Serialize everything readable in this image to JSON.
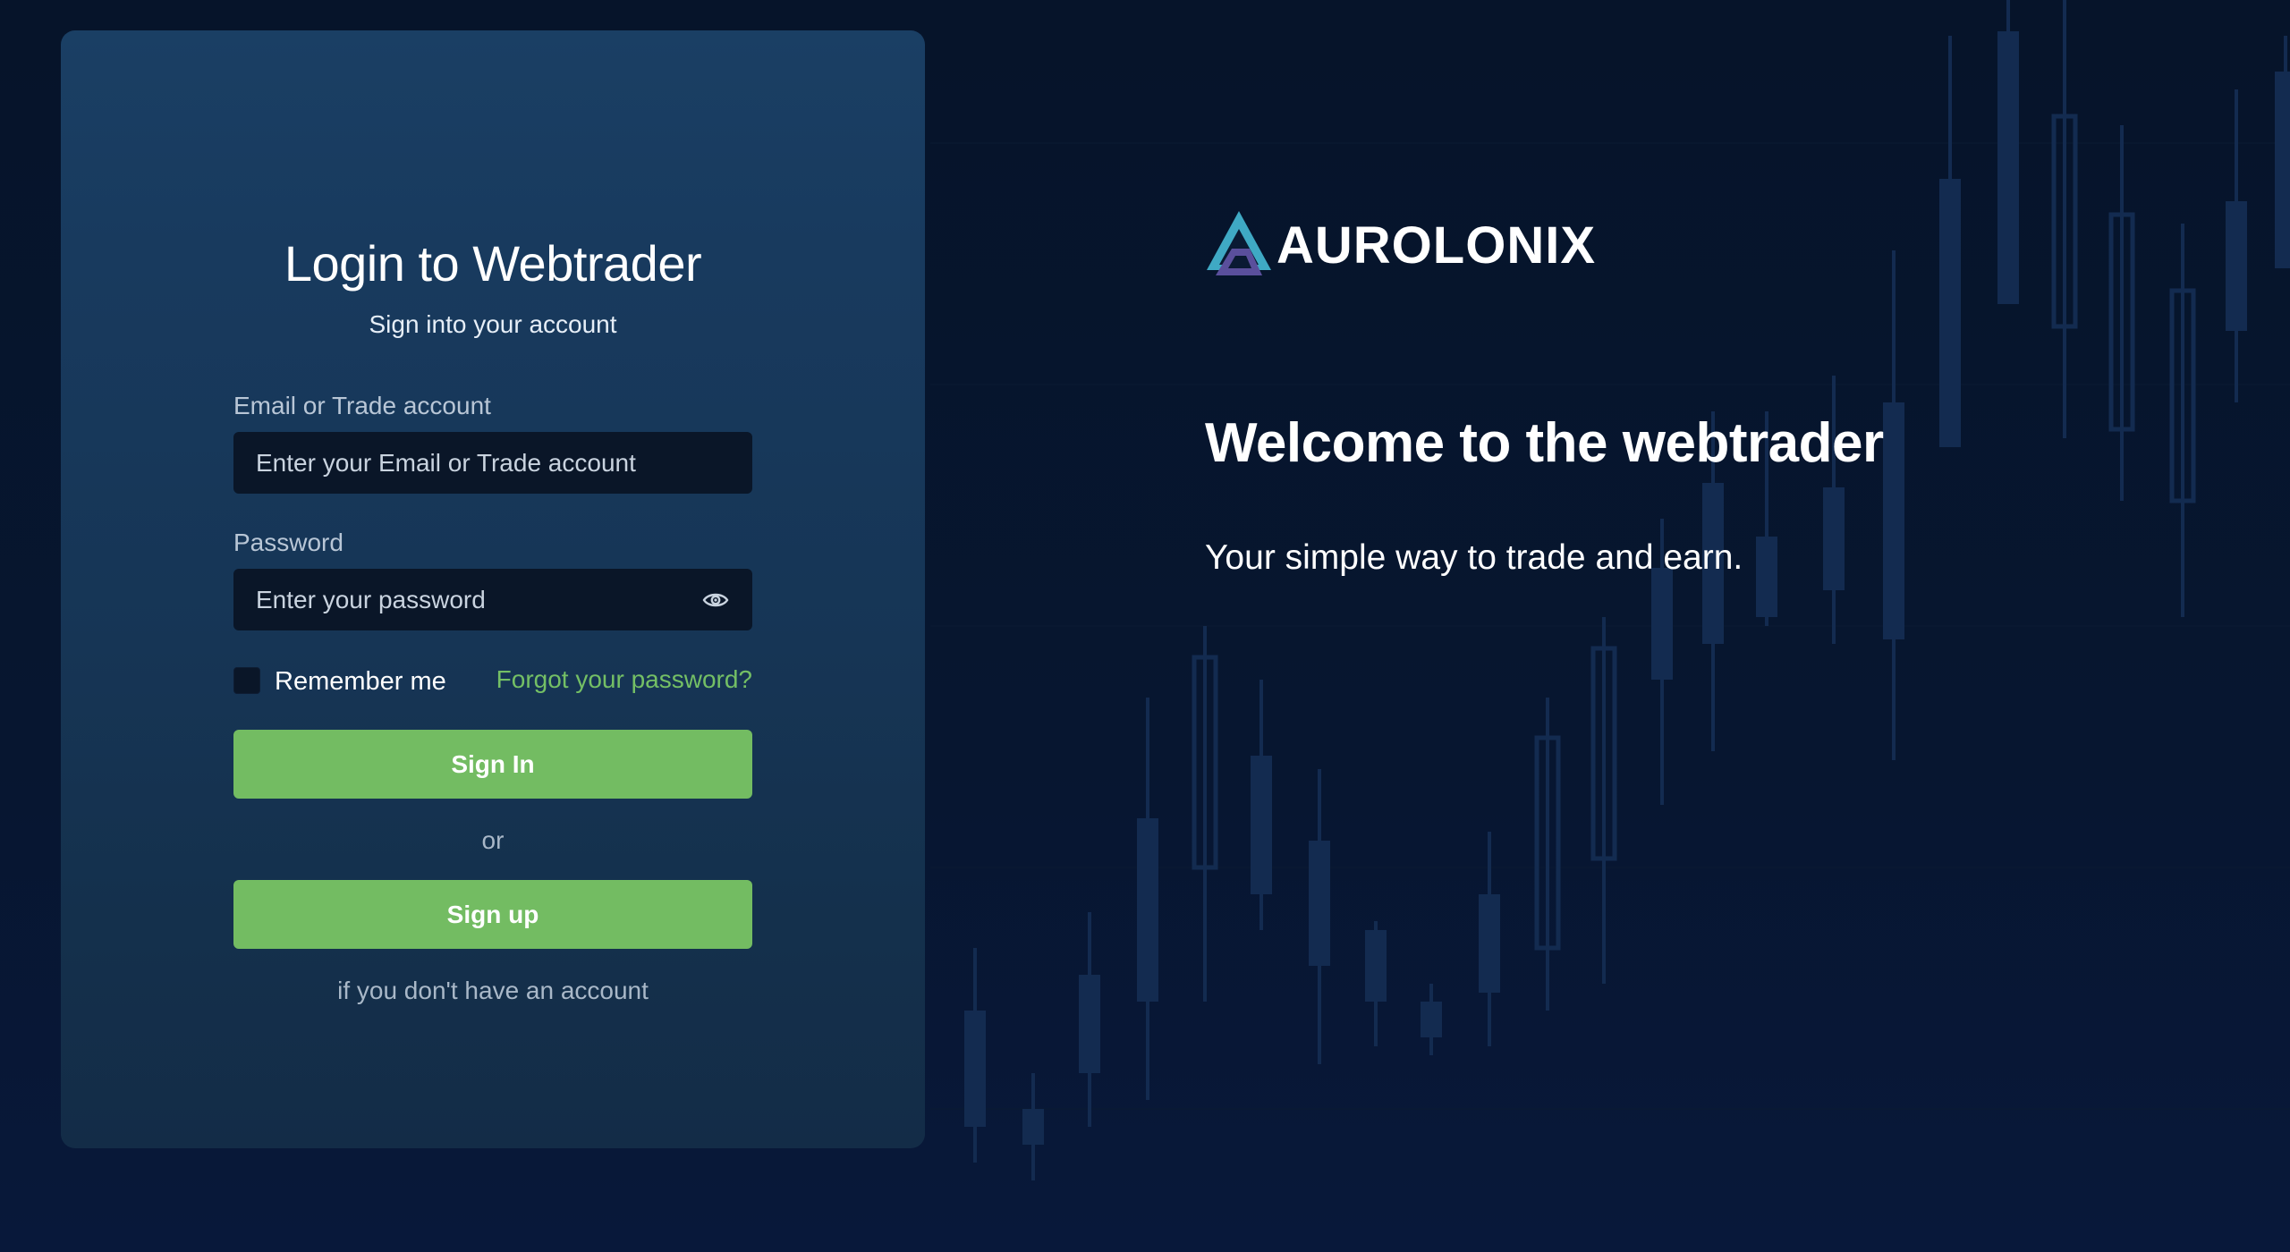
{
  "login": {
    "title": "Login to Webtrader",
    "subtitle": "Sign into your account",
    "email_label": "Email or Trade account",
    "email_placeholder": "Enter your Email or Trade account",
    "email_value": "",
    "password_label": "Password",
    "password_placeholder": "Enter your password",
    "password_value": "",
    "remember_label": "Remember me",
    "remember_checked": false,
    "forgot_label": "Forgot your password?",
    "signin_label": "Sign In",
    "or_label": "or",
    "signup_label": "Sign up",
    "signup_hint": "if you don't have an account"
  },
  "brand": {
    "name": "AUROLONIX",
    "logo_icon": "triangle-logo-icon"
  },
  "welcome": {
    "title": "Welcome to the webtrader",
    "subtitle": "Your simple way to trade and earn."
  },
  "icons": {
    "password_toggle": "eye-icon",
    "background": "candlestick-chart"
  },
  "colors": {
    "accent_green": "#73bc62",
    "link_green": "#74bf65",
    "background": "#061224",
    "card": "#183a5e",
    "input": "#0a1628",
    "logo_teal": "#3fa9c4",
    "logo_purple": "#5a4f9c"
  }
}
